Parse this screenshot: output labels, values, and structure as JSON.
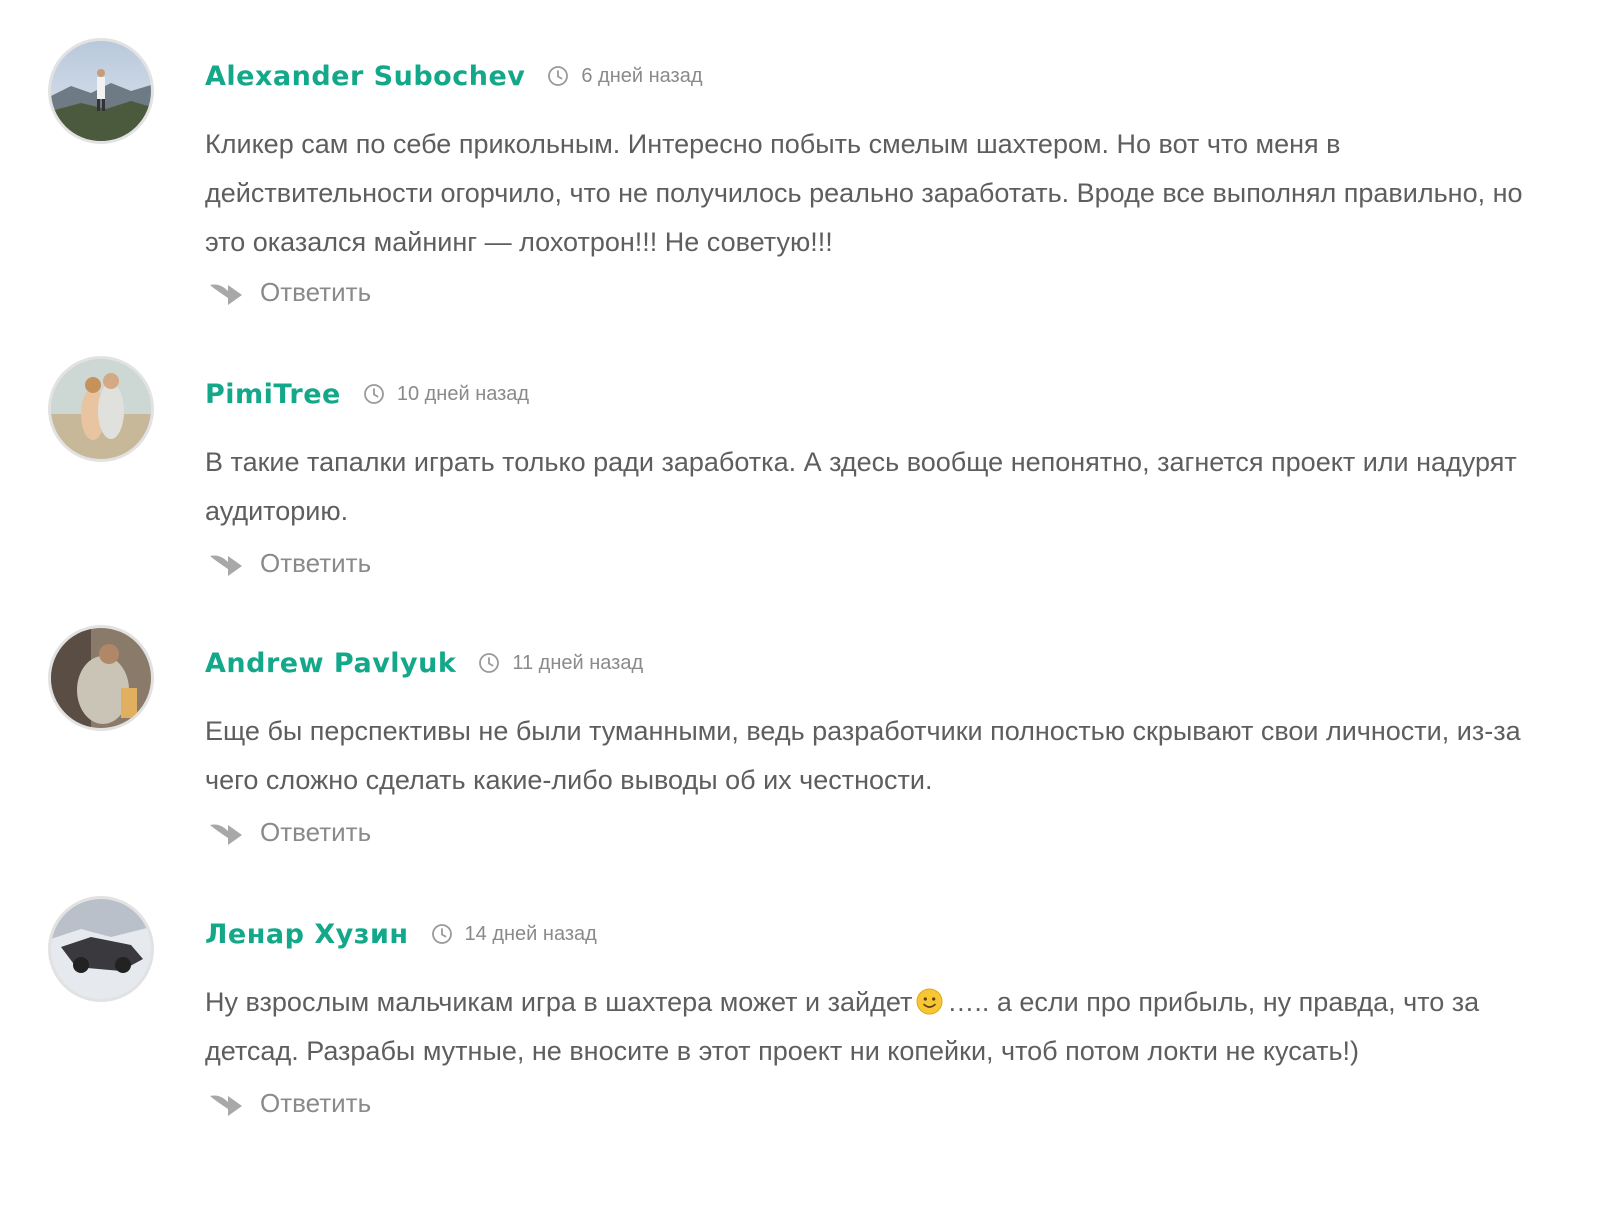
{
  "comments": [
    {
      "author": "Alexander Subochev",
      "time": "6 дней назад",
      "text": "Кликер сам по себе прикольным. Интересно побыть смелым шахтером. Но вот что меня в действительности огорчило, что не получилось реально заработать. Вроде все выполнял правильно, но это оказался майнинг — лохотрон!!! Не советую!!!",
      "reply_label": "Ответить"
    },
    {
      "author": "PimiTree",
      "time": "10 дней назад",
      "text": "В такие тапалки играть только ради заработка. А здесь вообще непонятно, загнется проект или надурят аудиторию.",
      "reply_label": "Ответить"
    },
    {
      "author": "Andrew Pavlyuk",
      "time": "11 дней назад",
      "text": "Еще бы перспективы не были туманными, ведь разработчики полностью скрывают свои личности, из-за чего сложно сделать какие-либо выводы об их честности.",
      "reply_label": "Ответить"
    },
    {
      "author": "Ленар Хузин",
      "time": "14 дней назад",
      "text_before_emoji": "Ну взрослым мальчикам игра в шахтера может и зайдет",
      "text_after_emoji": "….. а если про прибыль, ну правда, что за детсад. Разрабы мутные, не вносите в этот проект ни копейки, чтоб потом локти не кусать!)",
      "reply_label": "Ответить"
    }
  ],
  "icons": {
    "clock": "clock-icon",
    "reply": "reply-arrow-icon",
    "emoji": "slightly-smiling-face-icon"
  },
  "colors": {
    "author": "#14a88a",
    "text": "#5e5e5e",
    "meta": "#8a8a8a"
  }
}
